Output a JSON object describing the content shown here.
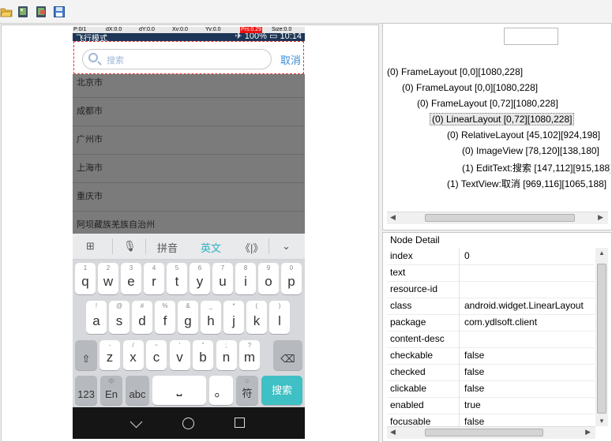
{
  "toolbar": {
    "buttons": [
      {
        "icon": "folder-open-icon"
      },
      {
        "icon": "device-screenshot-icon"
      },
      {
        "icon": "device-screenshot-compressed-icon"
      },
      {
        "icon": "save-icon"
      }
    ]
  },
  "device": {
    "debug_bar": {
      "p": "P:0/1",
      "dx": "dX:0.0",
      "dy": "dY:0.0",
      "xv": "Xv:0.0",
      "yv": "Yv:0.0",
      "prs": "Prs:0.29",
      "size": "Size:0.0"
    },
    "status": {
      "left": "飞行模式",
      "battery": "100%",
      "time": "10:14"
    },
    "search": {
      "placeholder": "搜索",
      "cancel": "取消"
    },
    "cities": [
      "北京市",
      "成都市",
      "广州市",
      "上海市",
      "重庆市",
      "阿坝藏族羌族自治州"
    ],
    "keyboard": {
      "top": {
        "pinyin": "拼音",
        "english": "英文",
        "cursor": "《|》"
      },
      "row1": [
        {
          "main": "q",
          "sub": "1"
        },
        {
          "main": "w",
          "sub": "2"
        },
        {
          "main": "e",
          "sub": "3"
        },
        {
          "main": "r",
          "sub": "4"
        },
        {
          "main": "t",
          "sub": "5"
        },
        {
          "main": "y",
          "sub": "6"
        },
        {
          "main": "u",
          "sub": "7"
        },
        {
          "main": "i",
          "sub": "8"
        },
        {
          "main": "o",
          "sub": "9"
        },
        {
          "main": "p",
          "sub": "0"
        }
      ],
      "row2": [
        {
          "main": "a",
          "sub": "!"
        },
        {
          "main": "s",
          "sub": "@"
        },
        {
          "main": "d",
          "sub": "#"
        },
        {
          "main": "f",
          "sub": "%"
        },
        {
          "main": "g",
          "sub": "&"
        },
        {
          "main": "h",
          "sub": "_"
        },
        {
          "main": "j",
          "sub": "*"
        },
        {
          "main": "k",
          "sub": "("
        },
        {
          "main": "l",
          "sub": ")"
        }
      ],
      "row3": [
        {
          "main": "z",
          "sub": "-"
        },
        {
          "main": "x",
          "sub": "/"
        },
        {
          "main": "c",
          "sub": "~"
        },
        {
          "main": "v",
          "sub": "'"
        },
        {
          "main": "b",
          "sub": "\""
        },
        {
          "main": "n",
          "sub": ";"
        },
        {
          "main": "m",
          "sub": "?"
        }
      ],
      "bottom": {
        "num": "123",
        "lang": "En",
        "lang_sub": "中",
        "abc": "abc",
        "dot": "。",
        "sym": "符",
        "sym_sub": "☺",
        "go": "搜索"
      }
    }
  },
  "tree": {
    "nodes": [
      "(0) FrameLayout [0,0][1080,228]",
      "(0) FrameLayout [0,0][1080,228]",
      "(0) FrameLayout [0,72][1080,228]",
      "(0) LinearLayout [0,72][1080,228]",
      "(0) RelativeLayout [45,102][924,198]",
      "(0) ImageView [78,120][138,180]",
      "(1) EditText:搜索 [147,112][915,188]",
      "(1) TextView:取消 [969,116][1065,188]"
    ]
  },
  "detail": {
    "title": "Node Detail",
    "rows": [
      {
        "key": "index",
        "value": "0"
      },
      {
        "key": "text",
        "value": ""
      },
      {
        "key": "resource-id",
        "value": ""
      },
      {
        "key": "class",
        "value": "android.widget.LinearLayout"
      },
      {
        "key": "package",
        "value": "com.ydlsoft.client"
      },
      {
        "key": "content-desc",
        "value": ""
      },
      {
        "key": "checkable",
        "value": "false"
      },
      {
        "key": "checked",
        "value": "false"
      },
      {
        "key": "clickable",
        "value": "false"
      },
      {
        "key": "enabled",
        "value": "true"
      },
      {
        "key": "focusable",
        "value": "false"
      }
    ]
  }
}
